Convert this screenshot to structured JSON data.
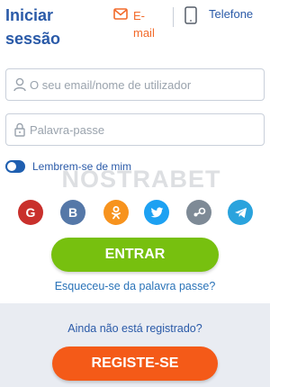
{
  "header": {
    "title": "Iniciar sessão",
    "tab_email": {
      "label": "E-mail",
      "icon": "envelope-icon",
      "active": true
    },
    "tab_phone": {
      "label": "Telefone",
      "icon": "phone-icon",
      "active": false
    }
  },
  "form": {
    "username": {
      "placeholder": "O seu email/nome de utilizador",
      "value": "",
      "icon": "user-icon"
    },
    "password": {
      "placeholder": "Palavra-passe",
      "value": "",
      "icon": "lock-icon"
    },
    "remember": {
      "label": "Lembrem-se de mim",
      "checked": true
    }
  },
  "watermark": "NOSTRABET",
  "social": [
    {
      "name": "google",
      "glyph": "G",
      "icon": "google-icon",
      "color": "#c9302c"
    },
    {
      "name": "vk",
      "glyph": "B",
      "icon": "vk-icon",
      "color": "#5578a8"
    },
    {
      "name": "odnoklassniki",
      "glyph": "",
      "icon": "odnoklassniki-icon",
      "color": "#f7931e"
    },
    {
      "name": "twitter",
      "glyph": "",
      "icon": "twitter-icon",
      "color": "#1da1f2"
    },
    {
      "name": "steam",
      "glyph": "",
      "icon": "steam-icon",
      "color": "#7e8a96"
    },
    {
      "name": "telegram",
      "glyph": "",
      "icon": "telegram-icon",
      "color": "#2aa3dd"
    }
  ],
  "actions": {
    "login_label": "ENTRAR",
    "forgot_label": "Esqueceu-se da palavra passe?",
    "not_registered": "Ainda não está registrado?",
    "register_label": "REGISTE-SE"
  },
  "colors": {
    "primary_text": "#2a5aa8",
    "accent_orange": "#f45a18",
    "login_green": "#77c00f",
    "toggle_blue": "#1f5fb0",
    "bottom_bg": "#e9ecf2"
  }
}
